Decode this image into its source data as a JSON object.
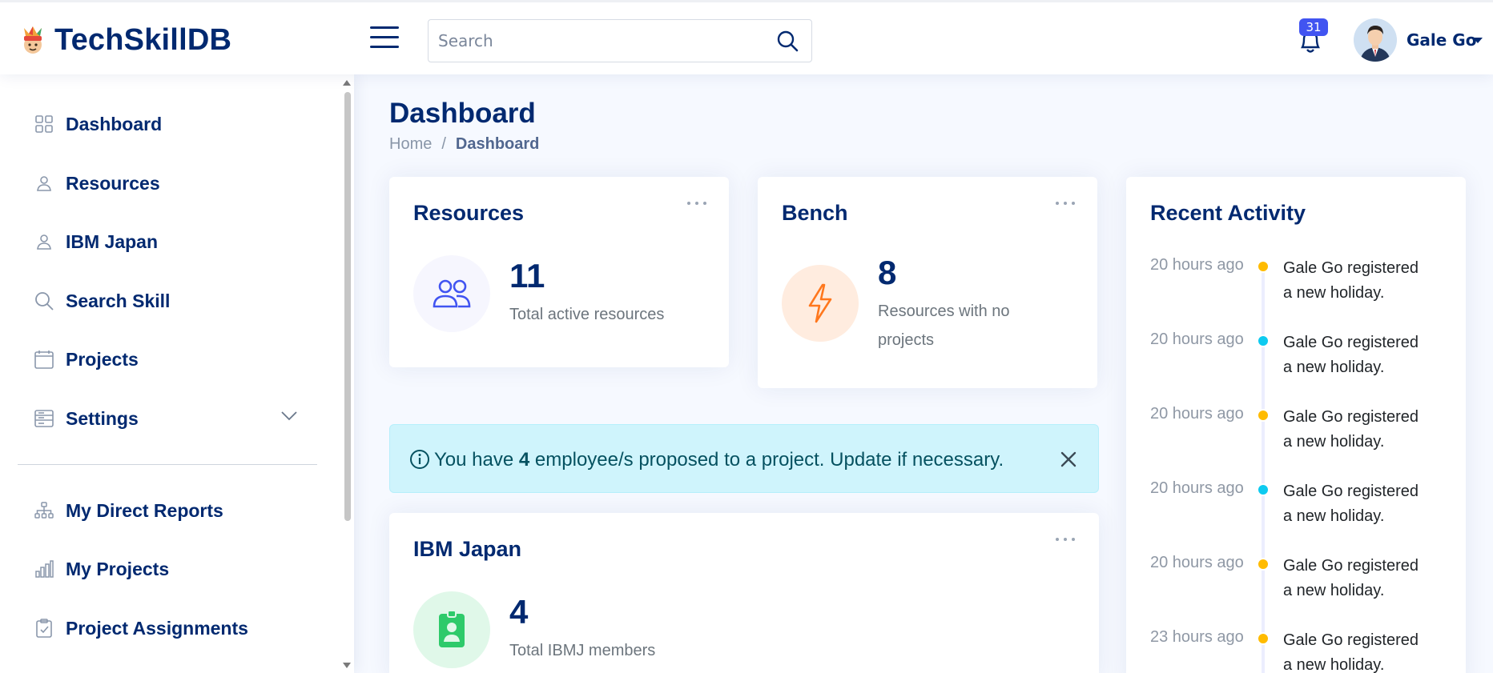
{
  "app": {
    "name": "TechSkillDB",
    "search_placeholder": "Search",
    "notifications_count": "31",
    "user_name": "Gale Go"
  },
  "colors": {
    "primary": "#012970",
    "accent": "#4154f1",
    "alert_bg": "#cff4fc",
    "dot_yellow": "#ffbb00",
    "dot_cyan": "#0dcaf0"
  },
  "sidebar": {
    "items": [
      {
        "label": "Dashboard",
        "icon": "grid-icon"
      },
      {
        "label": "Resources",
        "icon": "person-icon"
      },
      {
        "label": "IBM Japan",
        "icon": "person-icon"
      },
      {
        "label": "Search Skill",
        "icon": "search-icon"
      },
      {
        "label": "Projects",
        "icon": "calendar-icon"
      },
      {
        "label": "Settings",
        "icon": "layout-icon"
      },
      {
        "label": "My Direct Reports",
        "icon": "diagram-icon"
      },
      {
        "label": "My Projects",
        "icon": "bar-chart-icon"
      },
      {
        "label": "Project Assignments",
        "icon": "clipboard-check-icon"
      }
    ]
  },
  "page": {
    "title": "Dashboard",
    "breadcrumb": {
      "home": "Home",
      "separator": "/",
      "current": "Dashboard"
    }
  },
  "cards": {
    "resources": {
      "title": "Resources",
      "value": "11",
      "description": "Total active resources"
    },
    "bench": {
      "title": "Bench",
      "value": "8",
      "description_line1": "Resources with no",
      "description_line2": "projects"
    },
    "ibm_japan": {
      "title": "IBM Japan",
      "value": "4",
      "description": "Total IBMJ members"
    }
  },
  "alert": {
    "prefix": "You have",
    "count": "4",
    "suffix": "employee/s proposed to a project. Update if necessary."
  },
  "recent_activity": {
    "title": "Recent Activity",
    "items": [
      {
        "time": "20 hours ago",
        "line1": "Gale Go registered",
        "line2": "a new holiday.",
        "dot": "#ffbb00"
      },
      {
        "time": "20 hours ago",
        "line1": "Gale Go registered",
        "line2": "a new holiday.",
        "dot": "#0dcaf0"
      },
      {
        "time": "20 hours ago",
        "line1": "Gale Go registered",
        "line2": "a new holiday.",
        "dot": "#ffbb00"
      },
      {
        "time": "20 hours ago",
        "line1": "Gale Go registered",
        "line2": "a new holiday.",
        "dot": "#0dcaf0"
      },
      {
        "time": "20 hours ago",
        "line1": "Gale Go registered",
        "line2": "a new holiday.",
        "dot": "#ffbb00"
      },
      {
        "time": "23 hours ago",
        "line1": "Gale Go registered",
        "line2": "a new holiday.",
        "dot": "#ffbb00"
      }
    ]
  }
}
